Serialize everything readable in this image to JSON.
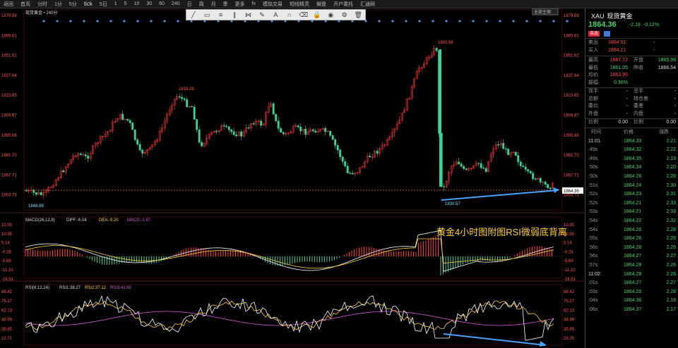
{
  "topbar": {
    "items": [
      "返回",
      "首页",
      "分时",
      "1分",
      "5分",
      "tick",
      "5日",
      "1",
      "5",
      "10",
      "30",
      "60",
      "240",
      "日",
      "周",
      "月",
      "季",
      "更多",
      "fx",
      "模拟交易",
      "短线精灵",
      "解盘",
      "开户委托",
      "汇通网"
    ]
  },
  "drawbar": {
    "icons": [
      "line-icon",
      "rect-icon",
      "fib-icon",
      "channel-icon",
      "pattern-icon",
      "pen-icon",
      "text-icon",
      "magnet-icon",
      "eraser-icon",
      "lock-icon",
      "eye-icon",
      "settings-icon",
      "trash-icon"
    ]
  },
  "main_chart": {
    "title": "现货黄金 • 240分",
    "y_labels": [
      "1879.59",
      "1865.61",
      "1851.62",
      "1837.64",
      "1823.65",
      "1809.67",
      "1895.68",
      "1881.70",
      "1867.71",
      "1853.73"
    ],
    "callout_high": "1865.58",
    "callout_mid_high": "1833.29",
    "callout_low_left": "1848.89",
    "callout_low_right": "1830.57",
    "current_price_tag": "1864.36",
    "toggle_label": "全部主图"
  },
  "macd": {
    "title": "MACD(26,12,9)",
    "diff_label": "DIFF:-6.04",
    "dea_label": "DEA:-5.20",
    "macd_label": "MACD:-1.67",
    "y_labels": [
      "10.95",
      "10.95",
      "5.14",
      "-0.28",
      "-5.69",
      "-11.10",
      "-16.51"
    ],
    "annotation": "黄金4小时图附图RSI微弱底背离"
  },
  "rsi": {
    "title": "RSI(6,12,24)",
    "rsi1_label": "RSI1:38.27",
    "rsi2_label": "RSI2:37.12",
    "rsi3_label": "RSI3:41.60",
    "y_labels": [
      "88.42",
      "75.27",
      "62.13",
      "48.99",
      "35.85",
      "22.71"
    ],
    "right_labels": [
      "88.42",
      "75.27",
      "62.13",
      "48.99",
      "35.85",
      "28.25"
    ]
  },
  "right_panel": {
    "code": "XAU",
    "name": "现货黄金",
    "price": "1864.36",
    "change": "-2.18",
    "change_pct": "-0.12%",
    "badge_buy": "自选",
    "buy_sell": [
      {
        "label": "卖出",
        "value": "1864.51",
        "extra": "-"
      },
      {
        "label": "买入",
        "value": "1864.21",
        "extra": "-"
      }
    ],
    "stats": [
      {
        "l1": "最高",
        "v1": "1867.72",
        "l2": "开盘",
        "v2": "1865.98"
      },
      {
        "l1": "最低",
        "v1": "1861.05",
        "l2": "昨收",
        "v2": "1866.54"
      },
      {
        "l1": "均价",
        "v1": "1863.95",
        "l2": "",
        "v2": ""
      },
      {
        "l1": "振幅",
        "v1": "0.36%",
        "l2": "",
        "v2": ""
      },
      {
        "l1": "现手",
        "v1": "-",
        "l2": "总手",
        "v2": "-"
      },
      {
        "l1": "总额",
        "v1": "-",
        "l2": "持仓差",
        "v2": "-"
      },
      {
        "l1": "委比",
        "v1": "-",
        "l2": "委差",
        "v2": "-"
      },
      {
        "l1": "外盘",
        "v1": "-",
        "l2": "内盘",
        "v2": "-"
      },
      {
        "l1": "比例",
        "v1": "0.00",
        "l2": "比例",
        "v2": "0.00"
      }
    ],
    "ticks_header": [
      "时间",
      "价格",
      "涨跌"
    ],
    "ticks": [
      {
        "t": "11:01",
        "p": "1864.33",
        "c": "2.21"
      },
      {
        "t": ":49s",
        "p": "1864.32",
        "c": "2.22"
      },
      {
        "t": ":49s",
        "p": "1864.35",
        "c": "2.19"
      },
      {
        "t": ":50s",
        "p": "1864.34",
        "c": "2.20"
      },
      {
        "t": ":50s",
        "p": "1864.26",
        "c": "2.28"
      },
      {
        "t": ":51s",
        "p": "1864.24",
        "c": "2.30"
      },
      {
        "t": ":52s",
        "p": "1864.23",
        "c": "2.31"
      },
      {
        "t": ":52s",
        "p": "1864.21",
        "c": "2.33"
      },
      {
        "t": ":53s",
        "p": "1864.21",
        "c": "2.33"
      },
      {
        "t": ":54s",
        "p": "1864.22",
        "c": "2.32"
      },
      {
        "t": ":54s",
        "p": "1864.26",
        "c": "2.28"
      },
      {
        "t": ":55s",
        "p": "1864.26",
        "c": "2.28"
      },
      {
        "t": ":56s",
        "p": "1864.28",
        "c": "2.26"
      },
      {
        "t": ":56s",
        "p": "1864.27",
        "c": "2.27"
      },
      {
        "t": ":57s",
        "p": "1864.28",
        "c": "2.26"
      },
      {
        "t": "11:02",
        "p": "1864.28",
        "c": "2.26"
      },
      {
        "t": ":01s",
        "p": "1864.27",
        "c": "2.27"
      },
      {
        "t": ":03s",
        "p": "1864.26",
        "c": "2.28"
      },
      {
        "t": ":04s",
        "p": "1864.36",
        "c": "2.18"
      },
      {
        "t": ":06s",
        "p": "1864.37",
        "c": "2.17"
      }
    ]
  }
}
